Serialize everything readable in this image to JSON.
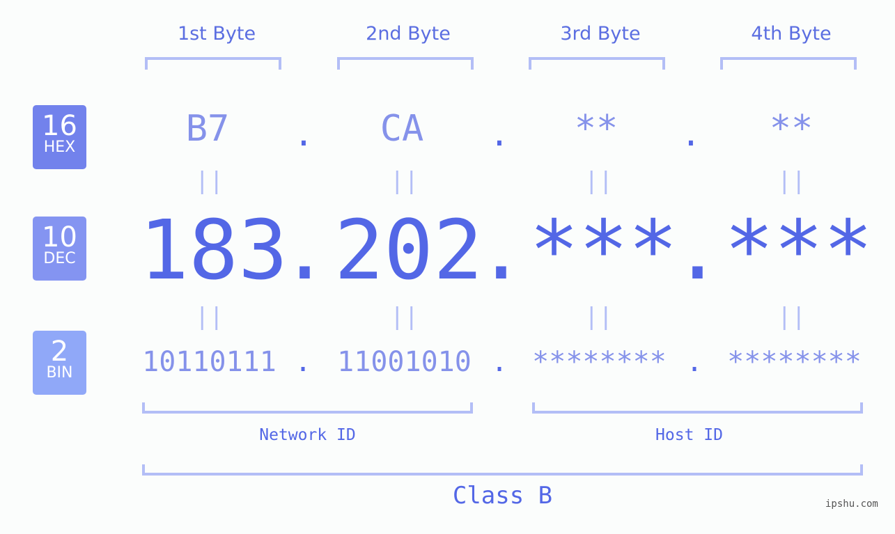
{
  "byte_headers": [
    "1st Byte",
    "2nd Byte",
    "3rd Byte",
    "4th Byte"
  ],
  "badges": [
    {
      "num": "16",
      "label": "HEX",
      "color": "#7282ec"
    },
    {
      "num": "10",
      "label": "DEC",
      "color": "#8494f1"
    },
    {
      "num": "2",
      "label": "BIN",
      "color": "#90a8f8"
    }
  ],
  "hex": [
    "B7",
    "CA",
    "**",
    "**"
  ],
  "dec": [
    "183",
    "202",
    "***",
    "***"
  ],
  "bin": [
    "10110111",
    "11001010",
    "********",
    "********"
  ],
  "separator": ".",
  "equals": "||",
  "network_id_label": "Network ID",
  "host_id_label": "Host ID",
  "class_label": "Class B",
  "watermark": "ipshu.com"
}
